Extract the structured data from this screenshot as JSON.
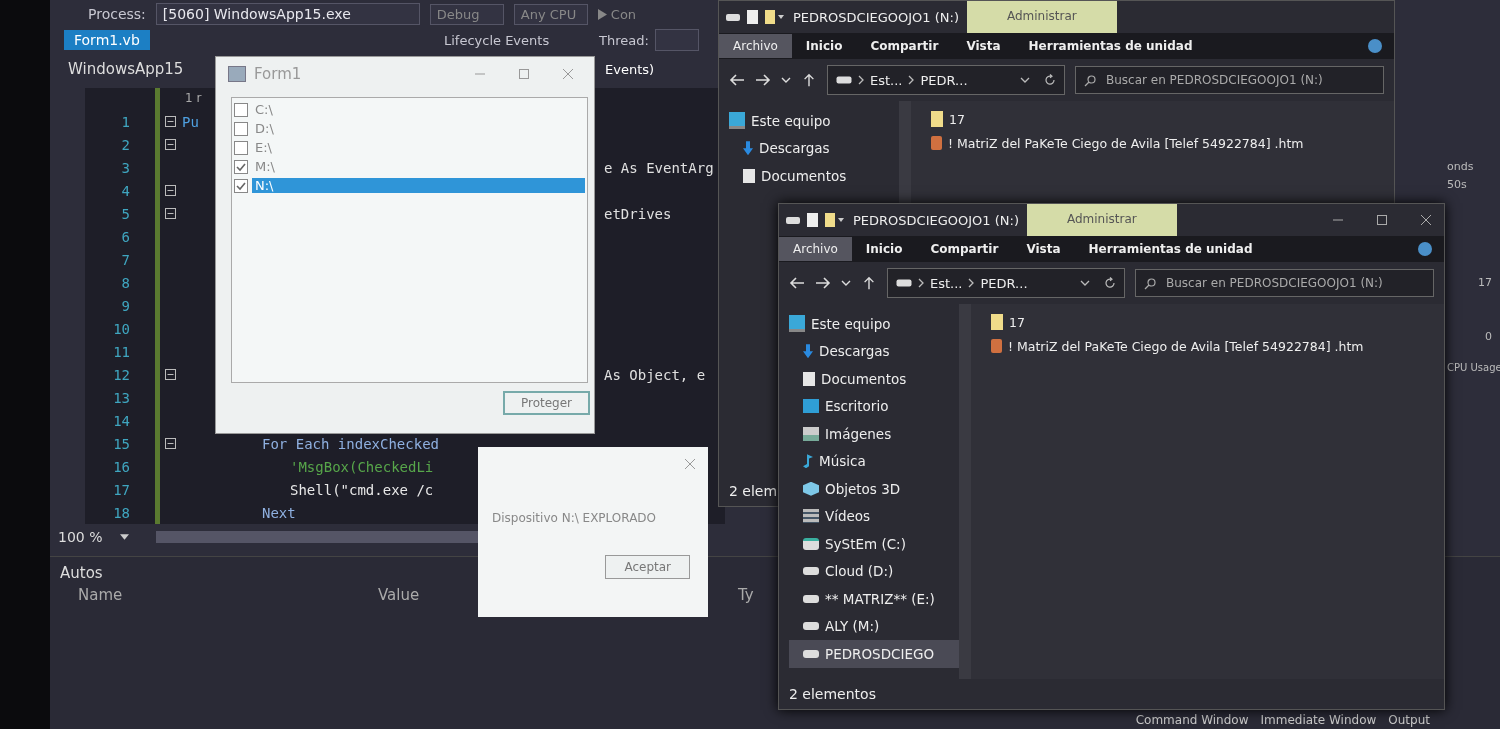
{
  "ide": {
    "toolbar": {
      "process_label": "Process:",
      "process": "[5060] WindowsApp15.exe",
      "configuration": "Debug",
      "platform": "Any CPU",
      "start": "Con",
      "lifecycle": "Lifecycle Events",
      "thread_label": "Thread:"
    },
    "tabs": [
      {
        "label": "Form1.vb",
        "selected": true
      }
    ],
    "navigation": {
      "project": "WindowsApp15",
      "member": "Events)"
    },
    "codelens": "1 r",
    "code_lines": [
      {
        "number": "1",
        "fold": true,
        "kind": "code",
        "text": "Pu"
      },
      {
        "number": "2",
        "fold": true
      },
      {
        "number": "3",
        "fold": false,
        "kind": "tail",
        "text": "e As EventArg"
      },
      {
        "number": "4",
        "fold": true
      },
      {
        "number": "5",
        "fold": true,
        "kind": "tail",
        "text": "etDrives"
      },
      {
        "number": "6",
        "fold": false
      },
      {
        "number": "7",
        "fold": false
      },
      {
        "number": "8",
        "fold": false
      },
      {
        "number": "9",
        "fold": false
      },
      {
        "number": "10",
        "fold": false
      },
      {
        "number": "11",
        "fold": false
      },
      {
        "number": "12",
        "fold": true,
        "kind": "tail",
        "text": "As Object, e"
      },
      {
        "number": "13",
        "fold": false
      },
      {
        "number": "14",
        "fold": false
      },
      {
        "number": "15",
        "fold": true,
        "kind": "block",
        "text": "For Each indexChecked"
      },
      {
        "number": "16",
        "fold": false,
        "kind": "comment",
        "text": "'MsgBox(CheckedLi"
      },
      {
        "number": "17",
        "fold": false,
        "kind": "nested",
        "text": "Shell(\"cmd.exe /c"
      },
      {
        "number": "18",
        "fold": false,
        "kind": "block",
        "text": "Next"
      }
    ],
    "zoom": "100 %",
    "autos": {
      "title": "Autos",
      "columns": [
        "Name",
        "Value",
        "Ty"
      ]
    },
    "diagnostics": {
      "header": "onds",
      "time": "50s",
      "max": "17",
      "min": "0",
      "legend": "CPU Usage"
    },
    "bottom_tabs": [
      {
        "label": "Command Window",
        "selected": false
      },
      {
        "label": "Immediate Window",
        "selected": false
      },
      {
        "label": "Output",
        "selected": false
      }
    ]
  },
  "explorers": [
    {
      "title": "PEDROSDCIEGOOJO1 (N:)",
      "context_tab": "Administrar",
      "controls": false,
      "ribbon_tabs": [
        {
          "label": "Archivo",
          "selected": true
        },
        {
          "label": "Inicio",
          "selected": false
        },
        {
          "label": "Compartir",
          "selected": false
        },
        {
          "label": "Vista",
          "selected": false
        },
        {
          "label": "Herramientas de unidad",
          "selected": false
        }
      ],
      "path": [
        "Est...",
        "PEDR..."
      ],
      "search": {
        "placeholder": "Buscar en PEDROSDCIEGOOJO1 (N:)"
      },
      "nav": [
        {
          "label": "Este equipo",
          "kind": "pc",
          "selected": false,
          "children": [
            {
              "label": "Descargas",
              "kind": "download",
              "selected": false
            },
            {
              "label": "Documentos",
              "kind": "doc",
              "selected": false
            }
          ]
        }
      ],
      "files": [
        {
          "name": "17",
          "kind": "folder"
        },
        {
          "name": "! MatriZ del PaKeTe Ciego de Avila [Telef 54922784] .htm",
          "kind": "web"
        }
      ],
      "status": "2 elem"
    },
    {
      "title": "PEDROSDCIEGOOJO1 (N:)",
      "context_tab": "Administrar",
      "controls": true,
      "ribbon_tabs": [
        {
          "label": "Archivo",
          "selected": true
        },
        {
          "label": "Inicio",
          "selected": false
        },
        {
          "label": "Compartir",
          "selected": false
        },
        {
          "label": "Vista",
          "selected": false
        },
        {
          "label": "Herramientas de unidad",
          "selected": false
        }
      ],
      "path": [
        "Est...",
        "PEDR..."
      ],
      "search": {
        "placeholder": "Buscar en PEDROSDCIEGOOJO1 (N:)"
      },
      "nav": [
        {
          "label": "Este equipo",
          "kind": "pc",
          "selected": false,
          "children": [
            {
              "label": "Descargas",
              "kind": "download",
              "selected": false
            },
            {
              "label": "Documentos",
              "kind": "doc",
              "selected": false
            },
            {
              "label": "Escritorio",
              "kind": "desktop",
              "selected": false
            },
            {
              "label": "Imágenes",
              "kind": "images",
              "selected": false
            },
            {
              "label": "Música",
              "kind": "music",
              "selected": false
            },
            {
              "label": "Objetos 3D",
              "kind": "cube",
              "selected": false
            },
            {
              "label": "Vídeos",
              "kind": "video",
              "selected": false
            },
            {
              "label": "SyStEm (C:)",
              "kind": "system",
              "selected": false
            },
            {
              "label": "Cloud (D:)",
              "kind": "drive",
              "selected": false
            },
            {
              "label": "** MATRIZ** (E:)",
              "kind": "drive",
              "selected": false
            },
            {
              "label": "ALY (M:)",
              "kind": "drive",
              "selected": false
            },
            {
              "label": "PEDROSDCIEGO",
              "kind": "drive",
              "selected": true
            }
          ]
        }
      ],
      "files": [
        {
          "name": "17",
          "kind": "folder"
        },
        {
          "name": "! MatriZ del PaKeTe Ciego de Avila [Telef 54922784] .htm",
          "kind": "web"
        }
      ],
      "status": "2 elementos"
    }
  ],
  "form": {
    "title": "Form1",
    "drives": [
      {
        "label": "C:\\",
        "checked": false,
        "selected": false
      },
      {
        "label": "D:\\",
        "checked": false,
        "selected": false
      },
      {
        "label": "E:\\",
        "checked": false,
        "selected": false
      },
      {
        "label": "M:\\",
        "checked": true,
        "selected": false
      },
      {
        "label": "N:\\",
        "checked": true,
        "selected": true
      }
    ],
    "button": "Proteger"
  },
  "message_box": {
    "text": "Dispositivo N:\\ EXPLORADO",
    "button": "Aceptar"
  }
}
